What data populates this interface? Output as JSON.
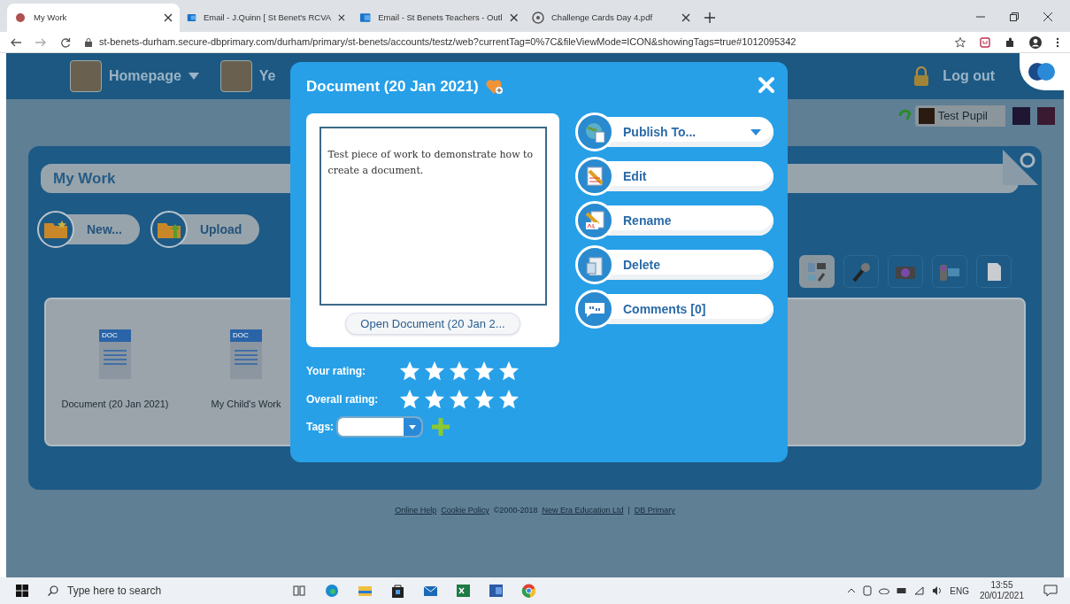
{
  "browser": {
    "tabs": [
      {
        "title": "My Work",
        "selected": true
      },
      {
        "title": "Email - J.Quinn [ St Benet's RCVA",
        "selected": false
      },
      {
        "title": "Email - St Benets Teachers - Outl",
        "selected": false
      },
      {
        "title": "Challenge Cards Day 4.pdf",
        "selected": false
      }
    ],
    "url": "st-benets-durham.secure-dbprimary.com/durham/primary/st-benets/accounts/testz/web?currentTag=0%7C&fileViewMode=ICON&showingTags=true#1012095342"
  },
  "nav": {
    "items": [
      "Homepage",
      "Ye"
    ],
    "logout": "Log out"
  },
  "user": {
    "name": "Test Pupil"
  },
  "panel": {
    "title": "My Work",
    "buttons": [
      "New...",
      "Upload"
    ],
    "media_tools": [
      {
        "selected": true
      },
      {
        "selected": false
      },
      {
        "selected": false
      },
      {
        "selected": false
      },
      {
        "selected": false
      }
    ],
    "files": [
      {
        "label": "DOC",
        "name": "Document (20 Jan 2021)"
      },
      {
        "label": "DOC",
        "name": "My Child's Work"
      }
    ]
  },
  "footer": [
    "Online Help",
    "Cookie Policy",
    "©2000-2018",
    "New Era Education Ltd",
    "|",
    "DB Primary"
  ],
  "dialog": {
    "title": "Document (20 Jan 2021)",
    "preview_text": "Test piece of work to demonstrate how to create a document.",
    "open_button": "Open Document (20 Jan 2...",
    "actions": [
      {
        "kind": "dropdown",
        "label": "Publish To..."
      },
      {
        "kind": "edit",
        "label": "Edit"
      },
      {
        "kind": "rename",
        "label": "Rename"
      },
      {
        "kind": "delete",
        "label": "Delete"
      },
      {
        "kind": "comments",
        "label": "Comments [0]"
      }
    ],
    "ratings": [
      {
        "label": "Your rating:",
        "stars": 5
      },
      {
        "label": "Overall rating:",
        "stars": 5
      }
    ],
    "tags_label": "Tags:"
  },
  "taskbar": {
    "search_placeholder": "Type here to search",
    "language": "ENG",
    "time": "13:55",
    "date": "20/01/2021"
  }
}
